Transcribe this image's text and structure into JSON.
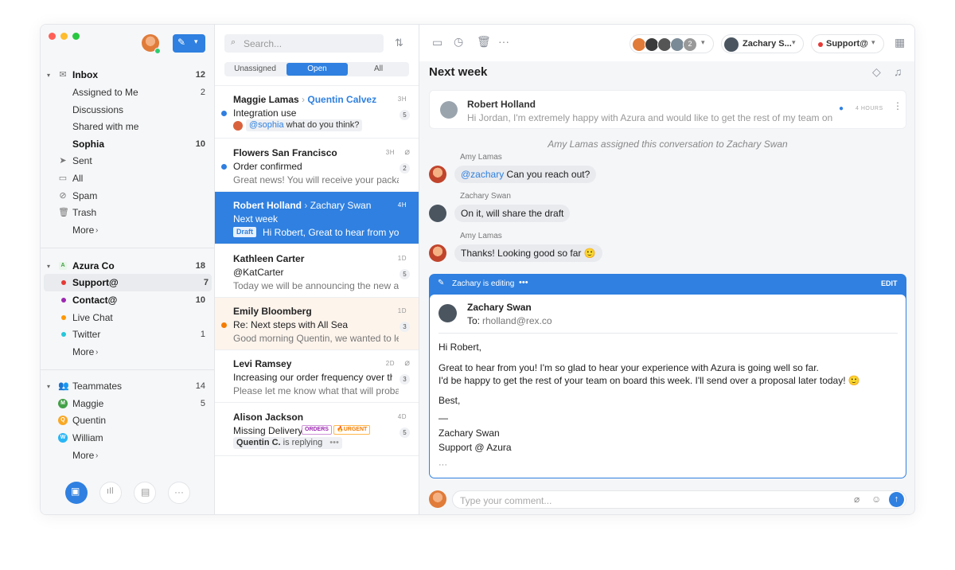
{
  "sidebar": {
    "inbox": {
      "label": "Inbox",
      "count": "12"
    },
    "inbox_items": [
      {
        "label": "Assigned to Me",
        "count": "2"
      },
      {
        "label": "Discussions",
        "count": ""
      },
      {
        "label": "Shared with me",
        "count": ""
      },
      {
        "label": "Sophia",
        "count": "10"
      }
    ],
    "folders": [
      {
        "label": "Sent",
        "icon": "send-icon"
      },
      {
        "label": "All",
        "icon": "archive-icon"
      },
      {
        "label": "Spam",
        "icon": "spam-icon"
      },
      {
        "label": "Trash",
        "icon": "trash-icon"
      }
    ],
    "more": "More",
    "team": {
      "label": "Azura Co",
      "badge": "A",
      "count": "18"
    },
    "team_items": [
      {
        "label": "Support@",
        "count": "7",
        "color": "#e53935"
      },
      {
        "label": "Contact@",
        "count": "10",
        "color": "#9c27b0"
      },
      {
        "label": "Live Chat",
        "count": "",
        "color": "#ff9800"
      },
      {
        "label": "Twitter",
        "count": "1",
        "color": "#26c6da"
      }
    ],
    "teammates": {
      "label": "Teammates",
      "count": "14"
    },
    "teammate_items": [
      {
        "label": "Maggie",
        "initial": "M",
        "color": "#43a047",
        "count": "5"
      },
      {
        "label": "Quentin",
        "initial": "Q",
        "color": "#f9a825",
        "count": ""
      },
      {
        "label": "William",
        "initial": "W",
        "color": "#29b6f6",
        "count": ""
      }
    ]
  },
  "list": {
    "search_placeholder": "Search...",
    "tabs": [
      "Unassigned",
      "Open",
      "All"
    ],
    "conversations": [
      {
        "name": "Maggie Lamas",
        "assignee": "Quentin Calvez",
        "subject": "Integration use",
        "preview_mention": "@sophia",
        "preview": "what do you think?",
        "time": "3H",
        "count": "5"
      },
      {
        "name": "Flowers San Francisco",
        "subject": "Order confirmed",
        "preview": "Great news! You will receive your packa...",
        "time": "3H",
        "count": "2"
      },
      {
        "name": "Robert Holland",
        "assignee": "Zachary Swan",
        "subject": "Next week",
        "draft": "Draft",
        "preview": "Hi Robert, Great to hear from yo...",
        "time": "4H"
      },
      {
        "name": "Kathleen Carter",
        "subject": "@KatCarter",
        "preview": "Today we will be announcing the new a...",
        "time": "1D",
        "count": "5"
      },
      {
        "name": "Emily Bloomberg",
        "subject": "Re: Next steps with All Sea",
        "preview": "Good morning Quentin, we wanted to le...",
        "time": "1D",
        "count": "3"
      },
      {
        "name": "Levi Ramsey",
        "subject": "Increasing our order frequency over the...",
        "preview": "Please let me know what that will proba...",
        "time": "2D",
        "count": "3"
      },
      {
        "name": "Alison Jackson",
        "subject": "Missing Delivery",
        "tag1": "ORDERS",
        "tag2": "URGENT",
        "typing_name": "Quentin C.",
        "typing": "is replying",
        "time": "4D",
        "count": "5"
      }
    ]
  },
  "conversation": {
    "title": "Next week",
    "assignee": "Zachary S...",
    "inbox": "Support@",
    "extra_count": "2",
    "first_message": {
      "sender": "Robert Holland",
      "preview": "Hi Jordan, I'm extremely happy with Azura and would like to get the rest of my team on it a...",
      "time": "4 HOURS"
    },
    "system_note": "Amy Lamas assigned this conversation to Zachary Swan",
    "comments": [
      {
        "author": "Amy Lamas",
        "mention": "@zachary",
        "text": "Can you reach out?"
      },
      {
        "author": "Zachary Swan",
        "mention": "",
        "text": "On it, will share the draft"
      },
      {
        "author": "Amy Lamas",
        "mention": "",
        "text": "Thanks! Looking good so far 🙂"
      }
    ],
    "draft": {
      "editing": "Zachary is editing",
      "edit_label": "EDIT",
      "from": "Zachary Swan",
      "to_label": "To:",
      "to": "rholland@rex.co",
      "greeting": "Hi Robert,",
      "body1": "Great to hear from you! I'm so glad to hear your experience with Azura is going well so far.",
      "body2": "I'd be happy to get the rest of your team on board this week. I'll send over a proposal later today! 🙂",
      "closing": "Best,",
      "dash": "—",
      "sig1": "Zachary Swan",
      "sig2": "Support @ Azura",
      "ellipsis": "···"
    },
    "comment_placeholder": "Type your comment..."
  },
  "colors": {
    "accent": "#2f80e0",
    "urgent": "#f57c00",
    "orders": "#9c27b0"
  }
}
